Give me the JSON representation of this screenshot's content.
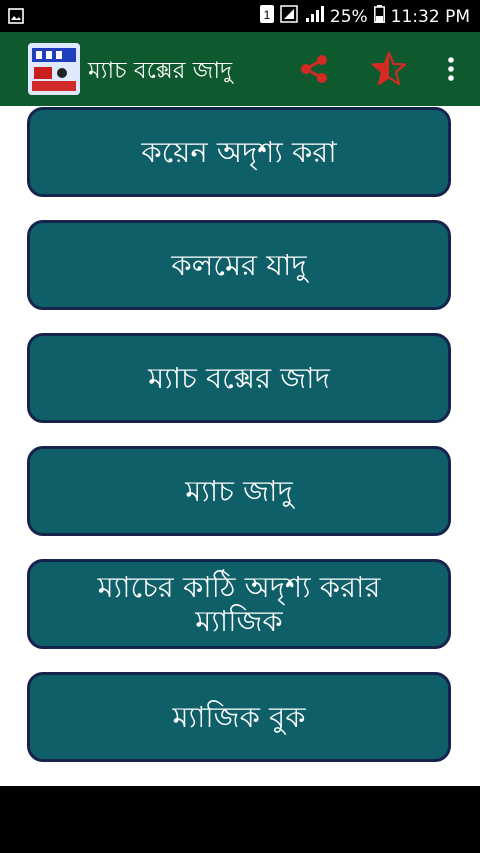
{
  "status_bar": {
    "sim_label": "1",
    "battery_text": "25%",
    "time": "11:32 PM"
  },
  "app_bar": {
    "title": "ম্যাচ বক্সের জাদু",
    "icons": [
      "app-logo",
      "share-icon",
      "star-icon",
      "more-vert-icon"
    ],
    "accent": "#0e5a2e",
    "action_color": "#d32b22"
  },
  "menu": {
    "button_color": "#0f5f68",
    "items": [
      {
        "label": "কয়েন অদৃশ্য করা"
      },
      {
        "label": "কলমের যাদু"
      },
      {
        "label": "ম্যাচ বক্সের জাদ"
      },
      {
        "label": "ম্যাচ জাদু"
      },
      {
        "label": "ম্যাচের কাঠি অদৃশ্য করার ম্যাজিক"
      },
      {
        "label": "ম্যাজিক বুক"
      }
    ]
  }
}
